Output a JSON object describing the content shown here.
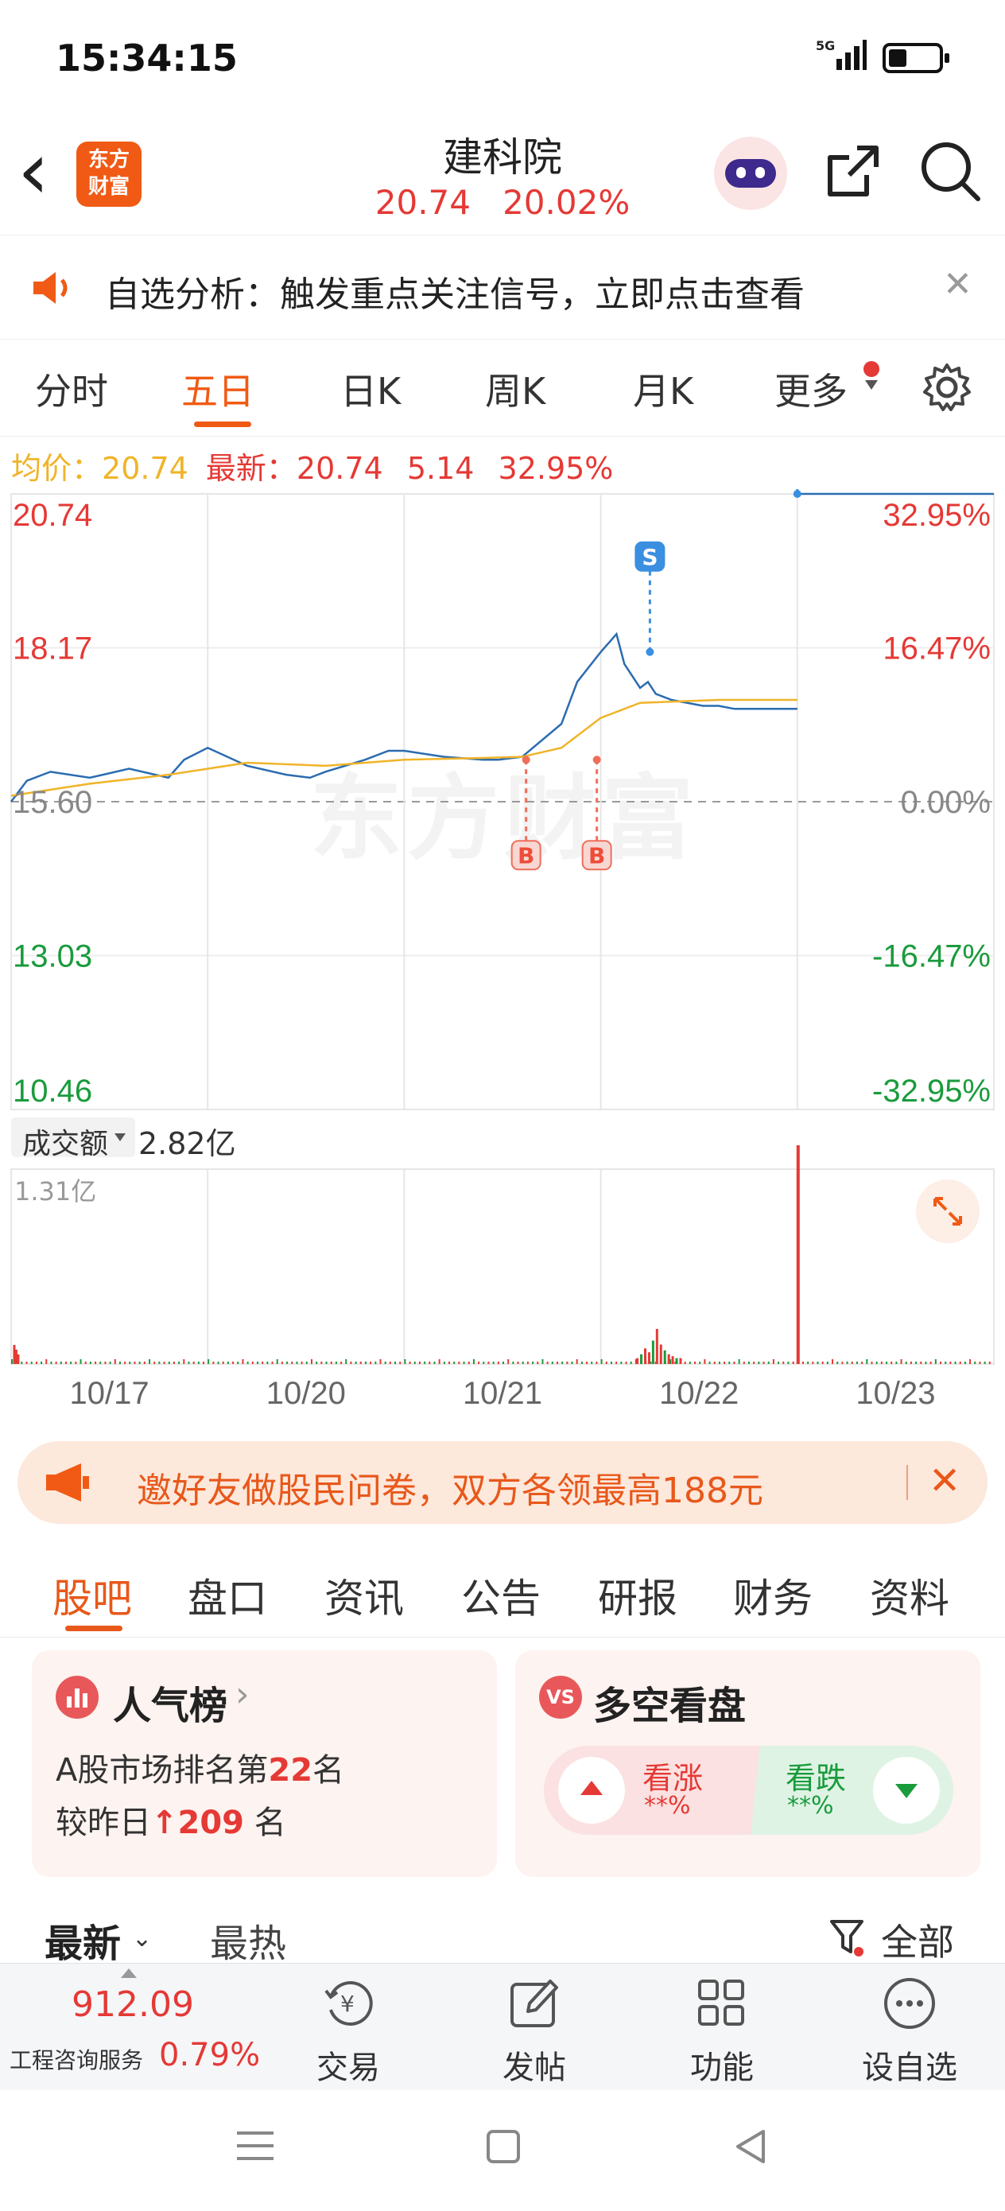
{
  "status": {
    "time": "15:34:15",
    "network": "5G"
  },
  "header": {
    "back": "‹",
    "logo_line1": "东方",
    "logo_line2": "财富",
    "title": "建科院",
    "price": "20.74",
    "change_pct": "20.02%"
  },
  "notice": {
    "text": "自选分析：触发重点关注信号，立即点击查看",
    "close": "✕"
  },
  "tabs": [
    "分时",
    "五日",
    "日K",
    "周K",
    "月K",
    "更多"
  ],
  "legend": {
    "avg_label": "均价：",
    "avg_value": "20.74",
    "latest_label": "最新：",
    "latest_value": "20.74",
    "change": "5.14",
    "change_pct": "32.95%"
  },
  "chart_data": {
    "type": "line",
    "title": "",
    "x_labels": [
      "10/17",
      "10/20",
      "10/21",
      "10/22",
      "10/23"
    ],
    "price_axis": [
      "20.74",
      "18.17",
      "15.60",
      "13.03",
      "10.46"
    ],
    "pct_axis": [
      "32.95%",
      "16.47%",
      "0.00%",
      "-16.47%",
      "-32.95%"
    ],
    "ylim": [
      10.46,
      20.74
    ],
    "base_price": 15.6,
    "grid": true,
    "series": [
      {
        "name": "price",
        "color": "#2b6cb0",
        "x": [
          0.0,
          0.02,
          0.05,
          0.1,
          0.15,
          0.2,
          0.22,
          0.25,
          0.3,
          0.35,
          0.38,
          0.4,
          0.45,
          0.48,
          0.5,
          0.55,
          0.6,
          0.62,
          0.65,
          0.7,
          0.72,
          0.75,
          0.77,
          0.78,
          0.8,
          0.81,
          0.82,
          0.84,
          0.86,
          0.88,
          0.9,
          0.92,
          0.95,
          0.98,
          1.0
        ],
        "y": [
          15.6,
          15.95,
          16.1,
          16.0,
          16.15,
          16.0,
          16.3,
          16.5,
          16.2,
          16.05,
          16.0,
          16.1,
          16.3,
          16.45,
          16.45,
          16.35,
          16.3,
          16.3,
          16.35,
          16.9,
          17.6,
          18.1,
          18.4,
          17.9,
          17.5,
          17.6,
          17.4,
          17.3,
          17.25,
          17.2,
          17.2,
          17.15,
          17.15,
          17.15,
          17.15
        ]
      },
      {
        "name": "avg",
        "color": "#f0b429",
        "x": [
          0.0,
          0.1,
          0.2,
          0.3,
          0.4,
          0.5,
          0.6,
          0.65,
          0.7,
          0.75,
          0.8,
          0.9,
          1.0
        ],
        "y": [
          15.7,
          15.9,
          16.05,
          16.25,
          16.2,
          16.3,
          16.33,
          16.35,
          16.5,
          17.0,
          17.25,
          17.3,
          17.3
        ]
      },
      {
        "name": "day5",
        "color": "#2b6cb0",
        "x": [
          0.0,
          1.0
        ],
        "y": [
          20.74,
          20.74
        ]
      }
    ],
    "markers": [
      {
        "label": "B",
        "type": "buy",
        "day": 3,
        "pos": 0.62,
        "price": 16.3
      },
      {
        "label": "B",
        "type": "buy",
        "day": 3,
        "pos": 0.98,
        "price": 16.3
      },
      {
        "label": "S",
        "type": "sell",
        "day": 4,
        "pos": 0.25,
        "price": 18.1
      },
      {
        "label": "S",
        "type": "sell",
        "day": 5,
        "pos": 0.0,
        "price": 20.74
      }
    ],
    "volume": {
      "label": "成交额",
      "total": "2.82亿",
      "max_label": "1.31亿",
      "bars_day4": [
        0.03,
        0.05,
        0.08,
        0.06,
        0.12,
        0.18,
        0.1,
        0.07,
        0.05,
        0.04,
        0.03,
        0.03
      ],
      "spike_day5": 1.0
    }
  },
  "watermark": "东方财富",
  "promo": {
    "text": "邀好友做股民问卷，双方各领最高188元",
    "close": "✕"
  },
  "subtabs": [
    "股吧",
    "盘口",
    "资讯",
    "公告",
    "研报",
    "财务",
    "资料"
  ],
  "popularity": {
    "title": "人气榜",
    "arrow": "›",
    "line1_pre": "A股市场排名第",
    "rank": "22",
    "line1_post": "名",
    "line2_pre": "较昨日",
    "change": "209",
    "line2_post": "名"
  },
  "vs": {
    "badge": "VS",
    "title": "多空看盘",
    "up_label": "看涨",
    "up_val": "**%",
    "down_label": "看跌",
    "down_val": "**%"
  },
  "feed": {
    "latest": "最新",
    "hot": "最热",
    "filter": "全部"
  },
  "bottom": {
    "index_value": "912.09",
    "index_name": "工程咨询服务",
    "index_pct": "0.79%",
    "trade": "交易",
    "post": "发帖",
    "func": "功能",
    "watch": "设自选"
  },
  "colors": {
    "up": "#e53935",
    "down": "#1a9b3c",
    "accent": "#f05a14",
    "avg": "#f0b429",
    "price": "#2b6cb0"
  }
}
